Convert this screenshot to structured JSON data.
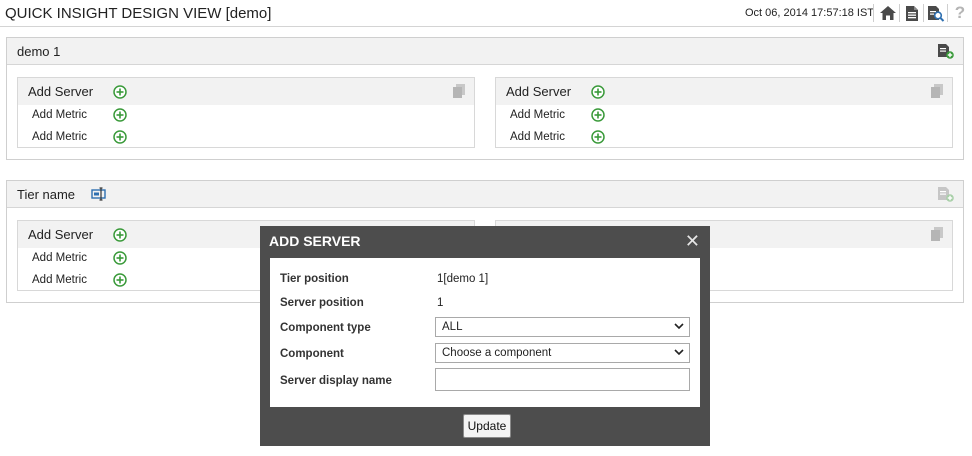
{
  "header": {
    "title": "QUICK INSIGHT DESIGN VIEW [demo]",
    "datetime": "Oct 06, 2014 17:57:18 IST",
    "icons": [
      "home-icon",
      "report-icon",
      "search-report-icon",
      "help-icon"
    ]
  },
  "tiers": [
    {
      "name": "demo 1",
      "servers": [
        {
          "title": "Add Server",
          "metrics": [
            "Add Metric",
            "Add Metric"
          ]
        },
        {
          "title": "Add Server",
          "metrics": [
            "Add Metric",
            "Add Metric"
          ]
        }
      ]
    },
    {
      "name": "Tier name",
      "servers": [
        {
          "title": "Add Server",
          "metrics": [
            "Add Metric",
            "Add Metric"
          ]
        },
        {
          "title": "",
          "metrics": []
        }
      ]
    }
  ],
  "modal": {
    "title": "ADD SERVER",
    "close": "✕",
    "fields": {
      "tier_position": {
        "label": "Tier position",
        "value": "1[demo 1]"
      },
      "server_position": {
        "label": "Server position",
        "value": "1"
      },
      "component_type": {
        "label": "Component type",
        "value": "ALL"
      },
      "component": {
        "label": "Component",
        "value": "Choose a component"
      },
      "server_display_name": {
        "label": "Server display name",
        "value": ""
      }
    },
    "update_label": "Update"
  },
  "colors": {
    "plus_green": "#3a9a3a",
    "modal_bg": "#4d4d4d",
    "panel_header": "#f2f2f2"
  }
}
